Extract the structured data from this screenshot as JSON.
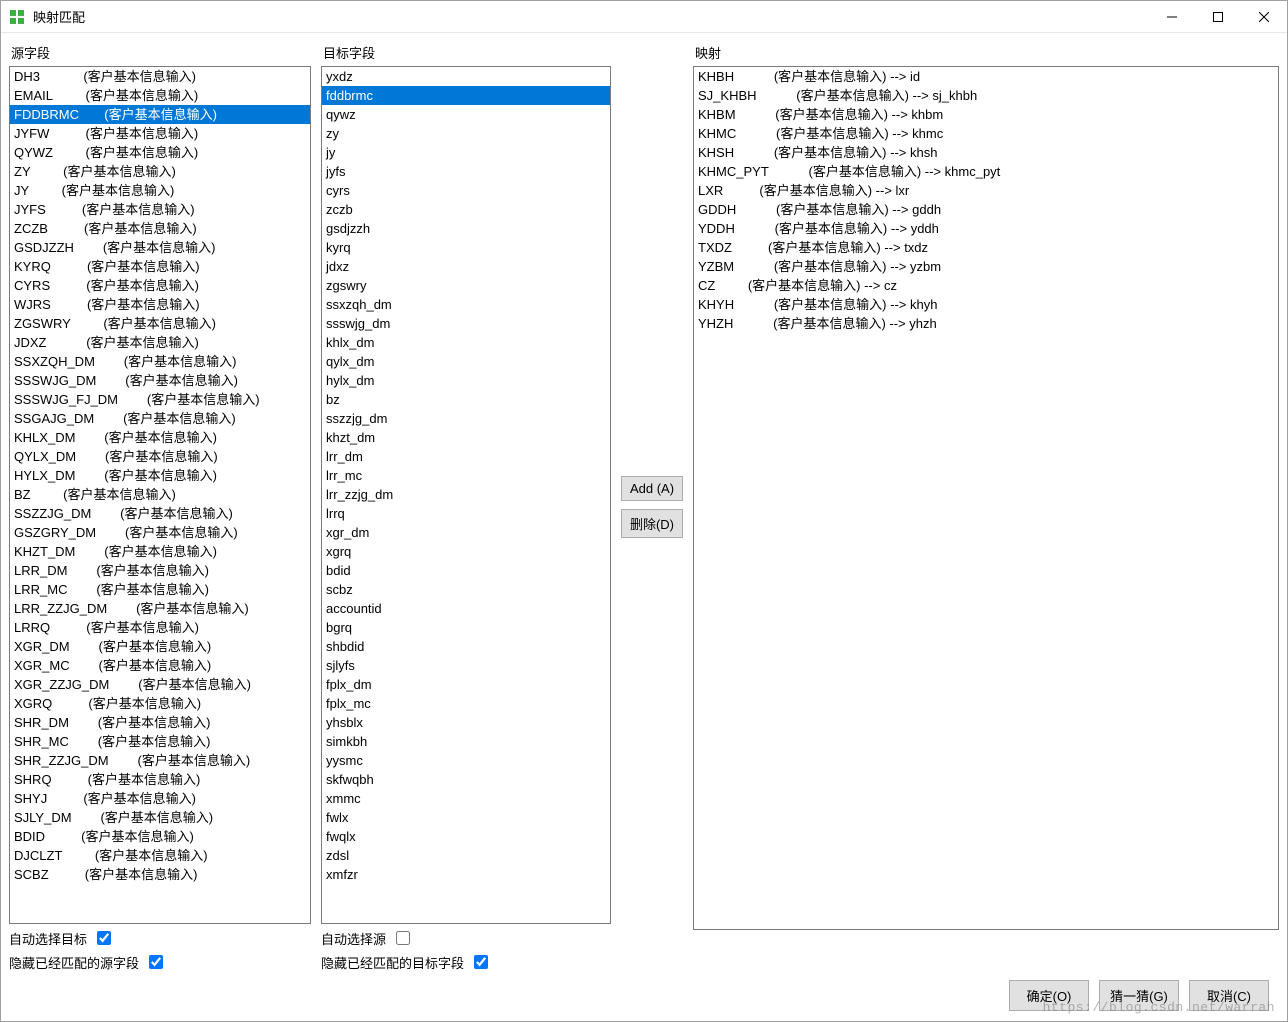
{
  "window": {
    "title": "映射匹配"
  },
  "labels": {
    "source": "源字段",
    "target": "目标字段",
    "mapping": "映射",
    "autoSelectTarget": "自动选择目标",
    "autoSelectSource": "自动选择源",
    "hideMatchedSource": "隐藏已经匹配的源字段",
    "hideMatchedTarget": "隐藏已经匹配的目标字段"
  },
  "buttons": {
    "add": "Add (A)",
    "delete": "删除(D)",
    "ok": "确定(O)",
    "guess": "猜一猜(G)",
    "cancel": "取消(C)"
  },
  "checkboxes": {
    "autoSelectTarget": true,
    "autoSelectSource": false,
    "hideMatchedSource": true,
    "hideMatchedTarget": true
  },
  "sourceAnnotation": "(客户基本信息输入)",
  "sourceFields": [
    {
      "name": "DH3",
      "pad": 12
    },
    {
      "name": "EMAIL",
      "pad": 9
    },
    {
      "name": "FDDBRMC",
      "pad": 7,
      "selected": true
    },
    {
      "name": "JYFW",
      "pad": 10
    },
    {
      "name": "QYWZ",
      "pad": 9
    },
    {
      "name": "ZY",
      "pad": 9
    },
    {
      "name": "JY",
      "pad": 9
    },
    {
      "name": "JYFS",
      "pad": 10
    },
    {
      "name": "ZCZB",
      "pad": 10
    },
    {
      "name": "GSDJZZH",
      "pad": 8
    },
    {
      "name": "KYRQ",
      "pad": 10
    },
    {
      "name": "CYRS",
      "pad": 10
    },
    {
      "name": "WJRS",
      "pad": 10
    },
    {
      "name": "ZGSWRY",
      "pad": 9
    },
    {
      "name": "JDXZ",
      "pad": 11
    },
    {
      "name": "SSXZQH_DM",
      "pad": 8
    },
    {
      "name": "SSSWJG_DM",
      "pad": 8
    },
    {
      "name": "SSSWJG_FJ_DM",
      "pad": 8
    },
    {
      "name": "SSGAJG_DM",
      "pad": 8
    },
    {
      "name": "KHLX_DM",
      "pad": 8
    },
    {
      "name": "QYLX_DM",
      "pad": 8
    },
    {
      "name": "HYLX_DM",
      "pad": 8
    },
    {
      "name": "BZ",
      "pad": 9
    },
    {
      "name": "SSZZJG_DM",
      "pad": 8
    },
    {
      "name": "GSZGRY_DM",
      "pad": 8
    },
    {
      "name": "KHZT_DM",
      "pad": 8
    },
    {
      "name": "LRR_DM",
      "pad": 8
    },
    {
      "name": "LRR_MC",
      "pad": 8
    },
    {
      "name": "LRR_ZZJG_DM",
      "pad": 8
    },
    {
      "name": "LRRQ",
      "pad": 10
    },
    {
      "name": "XGR_DM",
      "pad": 8
    },
    {
      "name": "XGR_MC",
      "pad": 8
    },
    {
      "name": "XGR_ZZJG_DM",
      "pad": 8
    },
    {
      "name": "XGRQ",
      "pad": 10
    },
    {
      "name": "SHR_DM",
      "pad": 8
    },
    {
      "name": "SHR_MC",
      "pad": 8
    },
    {
      "name": "SHR_ZZJG_DM",
      "pad": 8
    },
    {
      "name": "SHRQ",
      "pad": 10
    },
    {
      "name": "SHYJ",
      "pad": 10
    },
    {
      "name": "SJLY_DM",
      "pad": 8
    },
    {
      "name": "BDID",
      "pad": 10
    },
    {
      "name": "DJCLZT",
      "pad": 9
    },
    {
      "name": "SCBZ",
      "pad": 10
    }
  ],
  "targetFields": [
    {
      "name": "yxdz"
    },
    {
      "name": "fddbrmc",
      "selected": true
    },
    {
      "name": "qywz"
    },
    {
      "name": "zy"
    },
    {
      "name": "jy"
    },
    {
      "name": "jyfs"
    },
    {
      "name": "cyrs"
    },
    {
      "name": "zczb"
    },
    {
      "name": "gsdjzzh"
    },
    {
      "name": "kyrq"
    },
    {
      "name": "jdxz"
    },
    {
      "name": "zgswry"
    },
    {
      "name": "ssxzqh_dm"
    },
    {
      "name": "ssswjg_dm"
    },
    {
      "name": "khlx_dm"
    },
    {
      "name": "qylx_dm"
    },
    {
      "name": "hylx_dm"
    },
    {
      "name": "bz"
    },
    {
      "name": "sszzjg_dm"
    },
    {
      "name": "khzt_dm"
    },
    {
      "name": "lrr_dm"
    },
    {
      "name": "lrr_mc"
    },
    {
      "name": "lrr_zzjg_dm"
    },
    {
      "name": "lrrq"
    },
    {
      "name": "xgr_dm"
    },
    {
      "name": "xgrq"
    },
    {
      "name": "bdid"
    },
    {
      "name": "scbz"
    },
    {
      "name": "accountid"
    },
    {
      "name": "bgrq"
    },
    {
      "name": "shbdid"
    },
    {
      "name": "sjlyfs"
    },
    {
      "name": "fplx_dm"
    },
    {
      "name": "fplx_mc"
    },
    {
      "name": "yhsblx"
    },
    {
      "name": "simkbh"
    },
    {
      "name": "yysmc"
    },
    {
      "name": "skfwqbh"
    },
    {
      "name": "xmmc"
    },
    {
      "name": "fwlx"
    },
    {
      "name": "fwqlx"
    },
    {
      "name": "zdsl"
    },
    {
      "name": "xmfzr"
    }
  ],
  "mappings": [
    {
      "src": "KHBH",
      "pad": 11,
      "tgt": "id"
    },
    {
      "src": "SJ_KHBH",
      "pad": 11,
      "tgt": "sj_khbh"
    },
    {
      "src": "KHBM",
      "pad": 11,
      "tgt": "khbm"
    },
    {
      "src": "KHMC",
      "pad": 11,
      "tgt": "khmc"
    },
    {
      "src": "KHSH",
      "pad": 11,
      "tgt": "khsh"
    },
    {
      "src": "KHMC_PYT",
      "pad": 11,
      "tgt": "khmc_pyt"
    },
    {
      "src": "LXR",
      "pad": 10,
      "tgt": "lxr"
    },
    {
      "src": "GDDH",
      "pad": 11,
      "tgt": "gddh"
    },
    {
      "src": "YDDH",
      "pad": 11,
      "tgt": "yddh"
    },
    {
      "src": "TXDZ",
      "pad": 10,
      "tgt": "txdz"
    },
    {
      "src": "YZBM",
      "pad": 11,
      "tgt": "yzbm"
    },
    {
      "src": "CZ",
      "pad": 9,
      "tgt": "cz"
    },
    {
      "src": "KHYH",
      "pad": 11,
      "tgt": "khyh"
    },
    {
      "src": "YHZH",
      "pad": 11,
      "tgt": "yhzh"
    }
  ],
  "mappingArrow": " --> ",
  "watermark": "https://blog.csdn.net/warrah"
}
